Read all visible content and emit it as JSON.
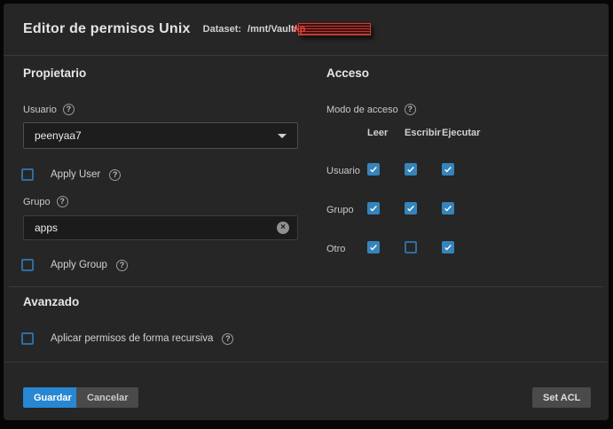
{
  "dialog": {
    "title": "Editor de permisos Unix",
    "dataset_label": "Dataset:",
    "dataset_path": "/mnt/Vault/",
    "dataset_redacted_visible": "Ap"
  },
  "owner": {
    "heading": "Propietario",
    "user_label": "Usuario",
    "user_value": "peenyaa7",
    "apply_user_label": "Apply User",
    "apply_user_checked": false,
    "group_label": "Grupo",
    "group_value": "apps",
    "apply_group_label": "Apply Group",
    "apply_group_checked": false
  },
  "access": {
    "heading": "Acceso",
    "mode_label": "Modo de acceso",
    "columns": [
      "Leer",
      "Escribir",
      "Ejecutar"
    ],
    "rows": [
      {
        "label": "Usuario",
        "states": [
          true,
          true,
          true
        ]
      },
      {
        "label": "Grupo",
        "states": [
          true,
          true,
          true
        ]
      },
      {
        "label": "Otro",
        "states": [
          true,
          false,
          true
        ]
      }
    ]
  },
  "advanced": {
    "heading": "Avanzado",
    "recursive_label": "Aplicar permisos de forma recursiva",
    "recursive_checked": false
  },
  "actions": {
    "save_label": "Guardar",
    "cancel_label": "Cancelar",
    "set_acl_label": "Set ACL"
  },
  "icons": {
    "help_glyph": "?",
    "clear_glyph": "×"
  },
  "colors": {
    "card_bg": "#262626",
    "outer_bg": "#060606",
    "divider": "#3a3a3a",
    "checkbox_checked": "#3584bb",
    "checkbox_border": "#2e6da4",
    "primary_button": "#2787d3",
    "plain_button": "#4a4a4a",
    "redaction_red": "#d63a34",
    "input_bg": "#1b1b1b"
  }
}
